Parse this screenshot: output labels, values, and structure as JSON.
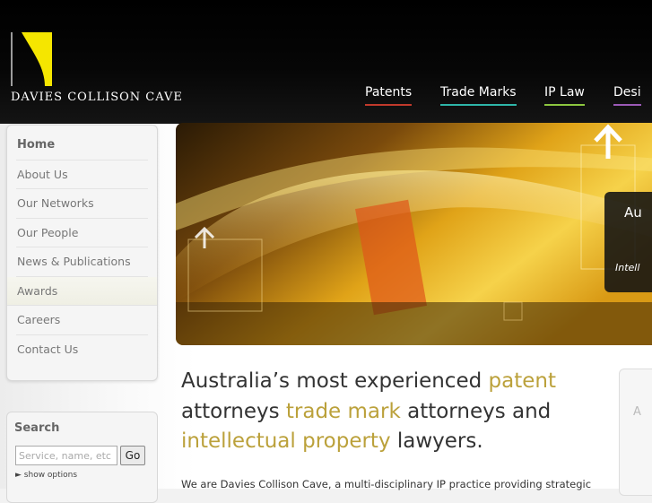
{
  "brand": {
    "name": "DAVIES COLLISON CAVE",
    "logo_color": "#f5e600"
  },
  "topnav": [
    {
      "label": "Patents",
      "underline": "#c0392b"
    },
    {
      "label": "Trade Marks",
      "underline": "#2eb5a8"
    },
    {
      "label": "IP Law",
      "underline": "#8cc63f"
    },
    {
      "label": "Desi",
      "underline": "#9b59b6"
    }
  ],
  "sidebar": {
    "items": [
      {
        "label": "Home"
      },
      {
        "label": "About Us"
      },
      {
        "label": "Our Networks"
      },
      {
        "label": "Our People"
      },
      {
        "label": "News & Publications"
      },
      {
        "label": "Awards"
      },
      {
        "label": "Careers"
      },
      {
        "label": "Contact Us"
      }
    ]
  },
  "banner": {
    "title": "Au",
    "subtitle": "Intell"
  },
  "headline": {
    "p1": "Australia’s most experienced ",
    "h1": "patent",
    "p2": " attorneys ",
    "h2": "trade mark",
    "p3": " attorneys and ",
    "h3": "intellectual property",
    "p4": " lawyers."
  },
  "intro": "We are Davies Collison Cave, a multi-disciplinary IP practice providing strategic",
  "search": {
    "title": "Search",
    "placeholder": "Service, name, etc",
    "go_label": "Go",
    "options_label": "show options"
  },
  "right_box": {
    "letter": "A"
  },
  "colors": {
    "accent_gold": "#bba13b",
    "header_bg": "#000000"
  }
}
